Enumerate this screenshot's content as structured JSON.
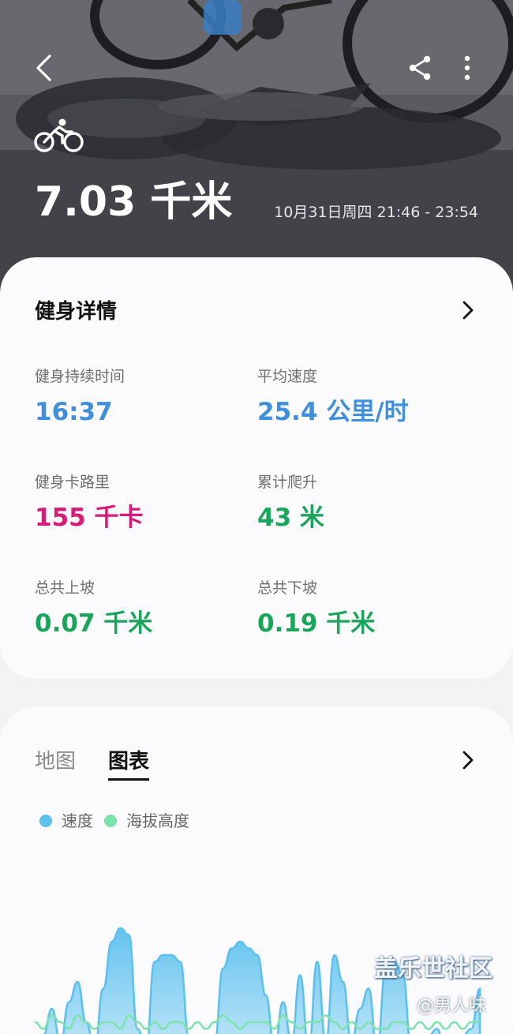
{
  "header": {
    "distance": "7.03 千米",
    "time_range": "10月31日周四 21:46 - 23:54",
    "sport_icon": "bicycle-icon",
    "actions": [
      "back-icon",
      "share-icon",
      "more-vertical-icon"
    ]
  },
  "details": {
    "title": "健身详情",
    "stats": [
      {
        "label": "健身持续时间",
        "value": "16:37",
        "color": "#3f8fdb"
      },
      {
        "label": "平均速度",
        "value": "25.4 公里/时",
        "color": "#3f8fdb"
      },
      {
        "label": "健身卡路里",
        "value": "155 千卡",
        "color": "#d81b78"
      },
      {
        "label": "累计爬升",
        "value": "43 米",
        "color": "#1aa65a"
      },
      {
        "label": "总共上坡",
        "value": "0.07 千米",
        "color": "#1aa65a"
      },
      {
        "label": "总共下坡",
        "value": "0.19 千米",
        "color": "#1aa65a"
      }
    ]
  },
  "chart_card": {
    "tabs": [
      {
        "label": "地图",
        "selected": false
      },
      {
        "label": "图表",
        "selected": true
      }
    ],
    "legend": [
      {
        "label": "速度",
        "color": "#5bc0ee"
      },
      {
        "label": "海拔高度",
        "color": "#7de3ad"
      }
    ]
  },
  "chart_data": {
    "type": "area",
    "series": [
      {
        "name": "速度",
        "color": "#5bc0ee",
        "values": [
          2,
          4,
          8,
          3,
          9,
          12,
          6,
          2,
          11,
          18,
          20,
          19,
          5,
          2,
          15,
          16,
          16,
          15,
          4,
          2,
          3,
          3,
          14,
          17,
          18,
          17,
          16,
          10,
          2,
          9,
          3,
          13,
          2,
          15,
          3,
          16,
          12,
          3,
          8,
          11,
          2,
          14,
          15,
          13,
          2,
          3,
          4,
          5,
          1,
          3,
          4,
          5,
          11
        ]
      },
      {
        "name": "海拔高度",
        "color": "#7de3ad",
        "values": [
          6,
          5,
          7,
          6,
          5,
          7,
          6,
          5,
          6,
          6,
          5,
          7,
          6,
          5,
          6,
          5,
          6,
          6,
          5,
          6,
          5,
          6,
          7,
          6,
          5,
          6,
          6,
          6,
          5,
          7,
          6,
          5,
          6,
          6,
          7,
          6,
          5,
          6,
          5,
          6,
          5,
          5,
          6,
          6,
          5,
          6,
          5,
          6,
          5,
          6,
          5,
          6,
          6
        ]
      }
    ]
  },
  "watermark": {
    "brand": "盖乐世社区",
    "user": "@男人味"
  }
}
